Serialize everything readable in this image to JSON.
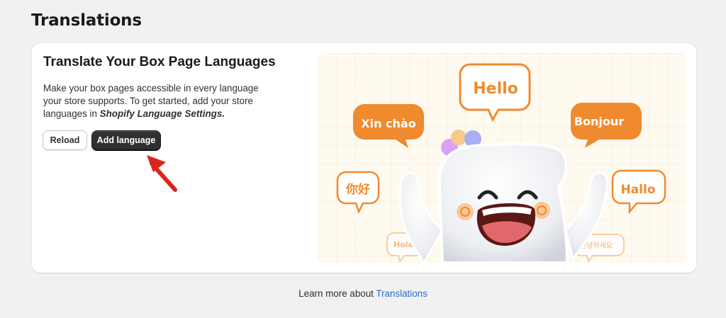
{
  "page": {
    "title": "Translations"
  },
  "card": {
    "title": "Translate Your Box Page Languages",
    "description": "Make your box pages accessible in every language your store supports. To get started, add your store languages in ",
    "description_emphasis": "Shopify Language Settings.",
    "reload_label": "Reload",
    "add_language_label": "Add language"
  },
  "illustration": {
    "bubbles": [
      "Hello",
      "Xin chào",
      "Bonjour",
      "你好",
      "Hallo",
      "Hola",
      "안녕하세요"
    ]
  },
  "footer": {
    "prefix": "Learn more about",
    "link": "Translations"
  },
  "colors": {
    "accent_orange": "#f08a2e",
    "primary_button": "#303030",
    "link": "#2c6ecb",
    "arrow": "#d9261c"
  }
}
